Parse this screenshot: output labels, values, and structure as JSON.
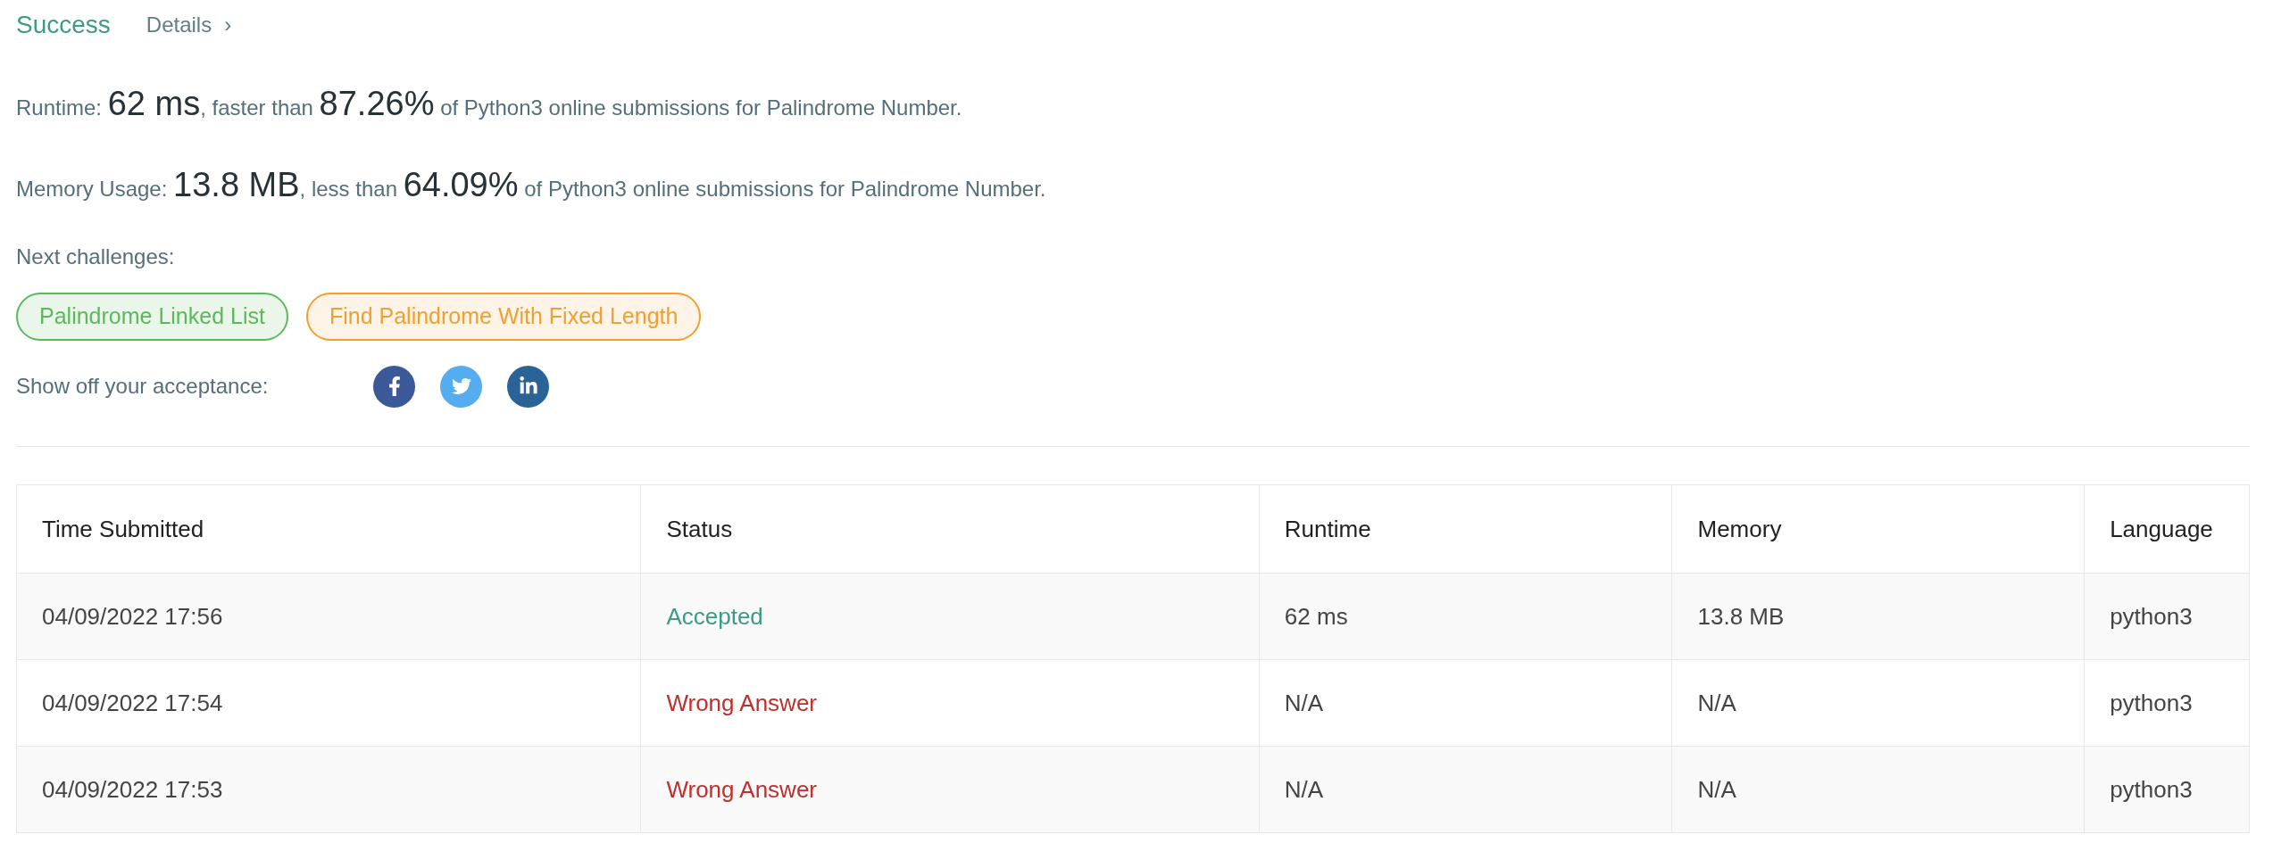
{
  "header": {
    "title": "Success",
    "details_link": "Details",
    "chevron": "›"
  },
  "runtime": [
    {
      "text": "Runtime: ",
      "emphasized": false
    },
    {
      "text": "62 ms",
      "emphasized": true
    },
    {
      "text": ", faster than ",
      "emphasized": false
    },
    {
      "text": "87.26%",
      "emphasized": true
    },
    {
      "text": " of Python3 online submissions for Palindrome Number.",
      "emphasized": false
    }
  ],
  "memory": [
    {
      "text": "Memory Usage: ",
      "emphasized": false
    },
    {
      "text": "13.8 MB",
      "emphasized": true
    },
    {
      "text": ", less than ",
      "emphasized": false
    },
    {
      "text": "64.09%",
      "emphasized": true
    },
    {
      "text": " of Python3 online submissions for Palindrome Number.",
      "emphasized": false
    }
  ],
  "next_challenges": {
    "label": "Next challenges:",
    "tags": [
      {
        "label": "Palindrome Linked List",
        "color": "#5cb85c"
      },
      {
        "label": "Find Palindrome With Fixed Length",
        "color": "#f0a030"
      }
    ]
  },
  "share": {
    "label": "Show off your acceptance:",
    "buttons": [
      {
        "kind": "facebook",
        "color": "#3b5998"
      },
      {
        "kind": "twitter",
        "color": "#55acee"
      },
      {
        "kind": "linkedin",
        "color": "#2a6496"
      }
    ]
  },
  "table": {
    "columns": [
      "Time Submitted",
      "Status",
      "Runtime",
      "Memory",
      "Language"
    ],
    "rows": [
      {
        "time": "04/09/2022 17:56",
        "status": "Accepted",
        "color": "#3c9a85",
        "runtime": "62 ms",
        "memory": "13.8 MB",
        "language": "python3"
      },
      {
        "time": "04/09/2022 17:54",
        "status": "Wrong Answer",
        "color": "#c12f2c",
        "runtime": "N/A",
        "memory": "N/A",
        "language": "python3"
      },
      {
        "time": "04/09/2022 17:53",
        "status": "Wrong Answer",
        "color": "#c12f2c",
        "runtime": "N/A",
        "memory": "N/A",
        "language": "python3"
      }
    ]
  }
}
